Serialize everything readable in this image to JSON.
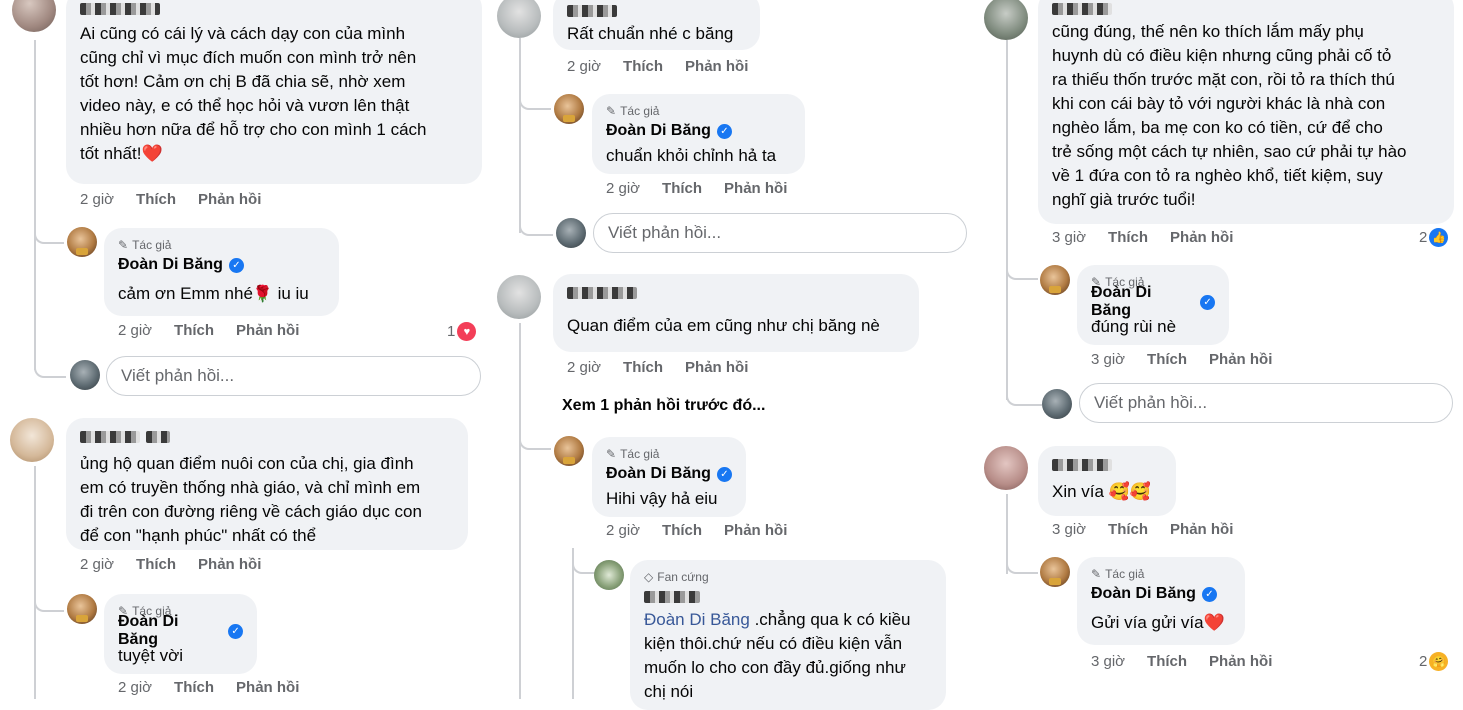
{
  "actions": {
    "like": "Thích",
    "reply": "Phản hồi"
  },
  "author_badge": "Tác giả",
  "fan_badge": "Fan cứng",
  "author_name": "Đoàn Di Băng",
  "reply_placeholder": "Viết phản hồi...",
  "col1": {
    "c1": {
      "text": "Ai cũng có cái lý và cách dạy con của mình\ncũng chỉ vì mục đích muốn con mình trở nên\ntốt hơn! Cảm ơn chị B đã chia sẽ, nhờ xem\nvideo này, e có thể học hỏi và vươn lên thật\nnhiều hơn nữa để    hỗ trợ cho con mình 1 cách\ntốt nhất!",
      "emoji": "❤️",
      "time": "2 giờ"
    },
    "r1": {
      "text": "cảm ơn Emm nhé",
      "emoji": "🌹",
      "tail": " iu iu",
      "time": "2 giờ",
      "react_count": "1"
    },
    "c2": {
      "text": "ủng hộ quan điểm nuôi con của chị, gia đình\nem có truyền thống nhà giáo, và chỉ mình em\nđi trên con đường riêng về cách giáo dục con\nđể con \"hạnh phúc\" nhất có thể",
      "time": "2 giờ"
    },
    "r2": {
      "text": "tuyệt vời",
      "time": "2 giờ"
    }
  },
  "col2": {
    "c1": {
      "text": "Rất chuẩn nhé c băng",
      "time": "2 giờ"
    },
    "r1": {
      "text": "chuẩn khỏi chỉnh hả ta",
      "time": "2 giờ"
    },
    "c2": {
      "text": "Quan điểm của em cũng như chị băng nè",
      "time": "2 giờ"
    },
    "view_more": "Xem 1 phản hồi trước đó...",
    "r2": {
      "text": "Hihi vậy hả eiu",
      "time": "2 giờ"
    },
    "fan_reply": {
      "mention": "Đoàn Di Băng",
      "text": " .chẳng qua k có kiều\nkiện thôi.chứ nếu có điều kiện vẫn\nmuốn lo cho con đầy đủ.giống như\nchị nói"
    }
  },
  "col3": {
    "c1": {
      "text": "cũng đúng, thế nên ko thích lắm mấy phụ\nhuynh dù có điều kiện nhưng cũng phải cố tỏ\nra thiếu thốn trước mặt con, rồi tỏ ra thích thú\nkhi con cái bày tỏ với người khác là nhà con\nnghèo lắm, ba mẹ con ko có tiền, cứ để cho\ntrẻ sống một cách tự nhiên, sao cứ phải tự hào\nvề 1 đứa con tỏ ra nghèo khổ, tiết kiệm, suy\nnghĩ già trước tuổi!",
      "time": "3 giờ",
      "react_count": "2"
    },
    "r1": {
      "text": "đúng rùi nè",
      "time": "3 giờ"
    },
    "c2": {
      "text": "Xin vía",
      "emoji": "🥰🥰",
      "time": "3 giờ"
    },
    "r2": {
      "text": "Gửi vía gửi vía",
      "emoji": "❤️",
      "time": "3 giờ",
      "react_count": "2"
    }
  },
  "icons": {
    "author": "pencil-icon",
    "fan": "diamond-icon",
    "verified": "verified-check-icon",
    "heart": "heart-reaction-icon",
    "like": "like-reaction-icon",
    "care": "care-reaction-icon"
  },
  "colors": {
    "verified": "#1877f2",
    "bubble": "#f0f2f5",
    "link": "#385898",
    "heart": "#f33e58"
  }
}
